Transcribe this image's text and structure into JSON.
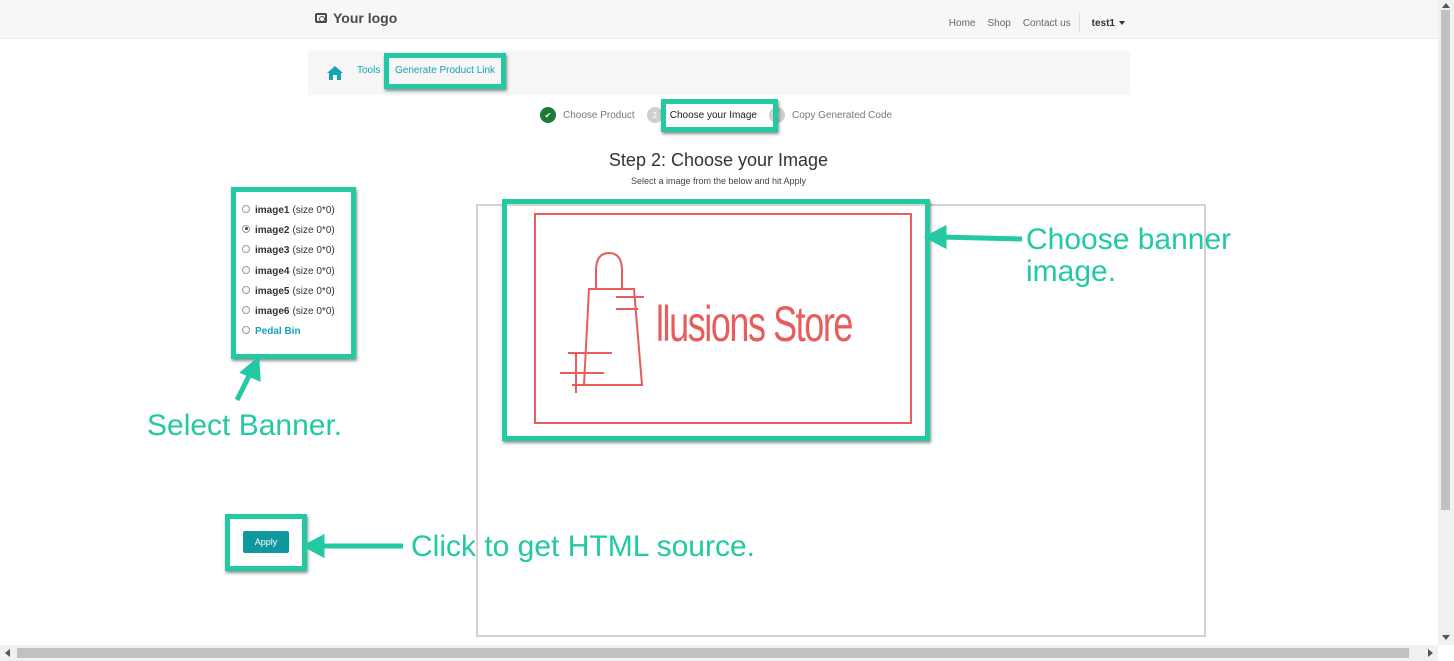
{
  "header": {
    "logo_text": "Your logo",
    "nav": [
      "Home",
      "Shop",
      "Contact us"
    ],
    "user": "test1"
  },
  "breadcrumb": {
    "items": [
      "Tools",
      "Generate Product Link"
    ]
  },
  "steps": [
    {
      "label": "Choose Product",
      "state": "done"
    },
    {
      "label": "Choose your Image",
      "state": "active",
      "number": "2"
    },
    {
      "label": "Copy Generated Code",
      "state": "todo",
      "number": "3"
    }
  ],
  "main": {
    "title": "Step 2: Choose your Image",
    "subtitle": "Select a image from the below and hit Apply",
    "apply_label": "Apply"
  },
  "options": [
    {
      "name": "image1",
      "size": "(size 0*0)",
      "checked": false
    },
    {
      "name": "image2",
      "size": "(size 0*0)",
      "checked": true
    },
    {
      "name": "image3",
      "size": "(size 0*0)",
      "checked": false
    },
    {
      "name": "image4",
      "size": "(size 0*0)",
      "checked": false
    },
    {
      "name": "image5",
      "size": "(size 0*0)",
      "checked": false
    },
    {
      "name": "image6",
      "size": "(size 0*0)",
      "checked": false
    },
    {
      "name": "Pedal Bin",
      "size": "",
      "checked": false
    }
  ],
  "banner": {
    "store_name": "llusions Store",
    "color": "#e85c5c"
  },
  "annotations": {
    "select_banner": "Select Banner.",
    "choose_banner_line1": "Choose banner",
    "choose_banner_line2": "image.",
    "click_apply": "Click to get HTML source.",
    "color": "#22c9a3"
  }
}
